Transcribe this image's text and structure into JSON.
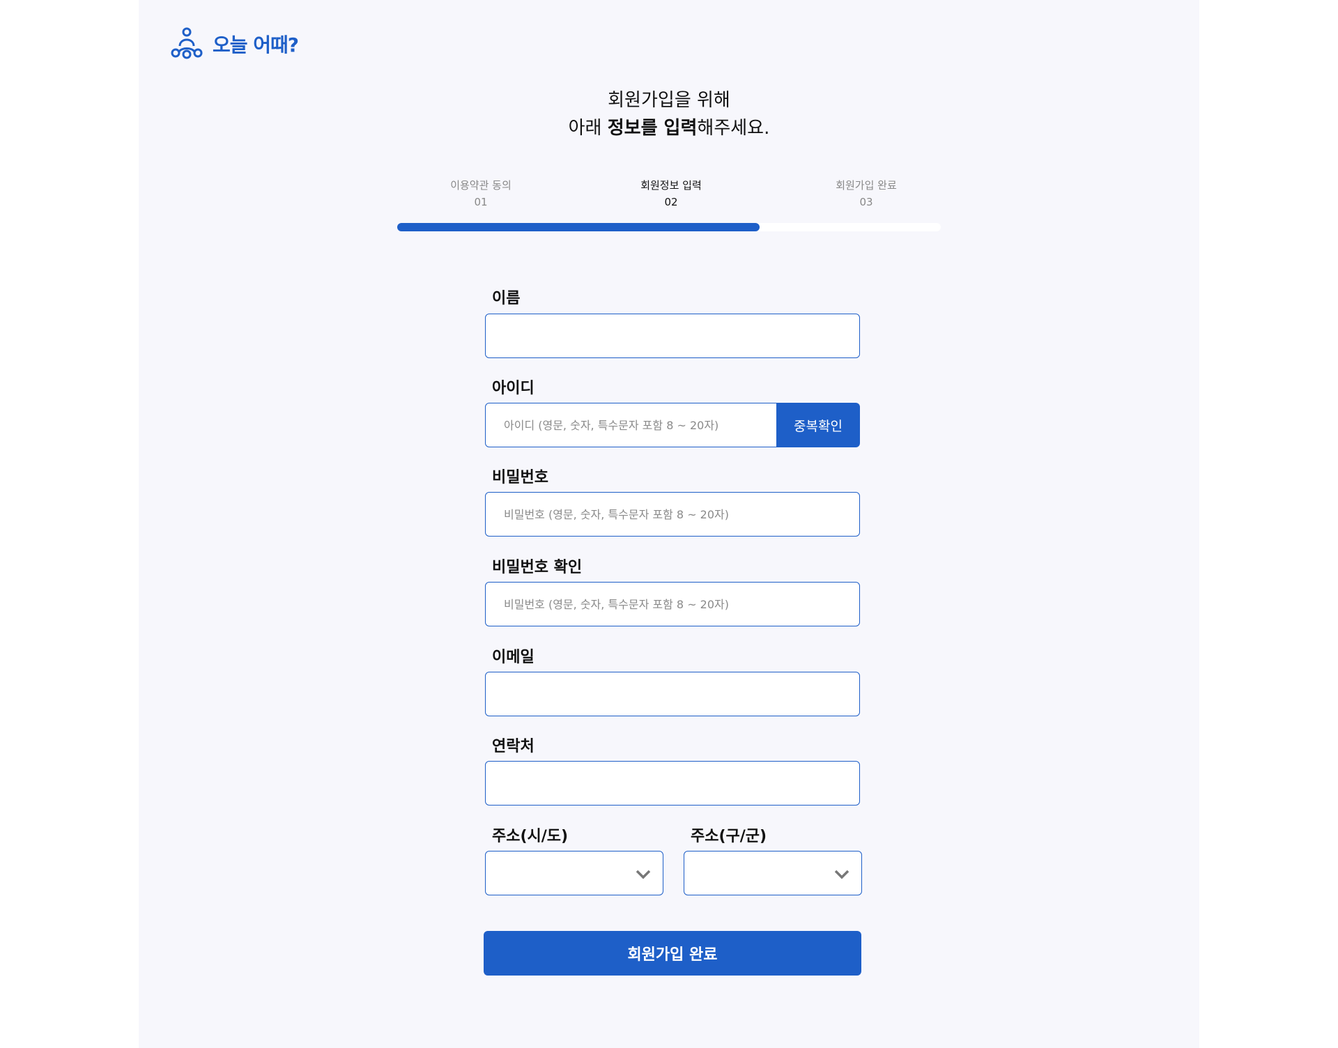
{
  "brand": {
    "name": "오늘 어때?",
    "logo_icon": "people-cluster-icon",
    "accent_color": "#1e5fc8"
  },
  "headline": {
    "line1": "회원가입을 위해",
    "line2_prefix": "아래 ",
    "line2_bold": "정보를 입력",
    "line2_suffix": "해주세요."
  },
  "steps": [
    {
      "label": "이용약관 동의",
      "number": "01",
      "active": false
    },
    {
      "label": "회원정보 입력",
      "number": "02",
      "active": true
    },
    {
      "label": "회원가입 완료",
      "number": "03",
      "active": false
    }
  ],
  "progress": {
    "fraction": 0.667
  },
  "form": {
    "name": {
      "label": "이름",
      "value": "",
      "placeholder": ""
    },
    "user_id": {
      "label": "아이디",
      "value": "",
      "placeholder": "아이디 (영문, 숫자, 특수문자 포함 8 ~ 20자)",
      "check_button": "중복확인"
    },
    "password": {
      "label": "비밀번호",
      "value": "",
      "placeholder": "비밀번호 (영문, 숫자, 특수문자 포함 8 ~ 20자)"
    },
    "password_confirm": {
      "label": "비밀번호 확인",
      "value": "",
      "placeholder": "비밀번호 (영문, 숫자, 특수문자 포함 8 ~ 20자)"
    },
    "email": {
      "label": "이메일",
      "value": "",
      "placeholder": ""
    },
    "phone": {
      "label": "연락처",
      "value": "",
      "placeholder": ""
    },
    "address_city": {
      "label": "주소(시/도)",
      "selected": ""
    },
    "address_district": {
      "label": "주소(구/군)",
      "selected": ""
    },
    "submit_label": "회원가입 완료"
  }
}
